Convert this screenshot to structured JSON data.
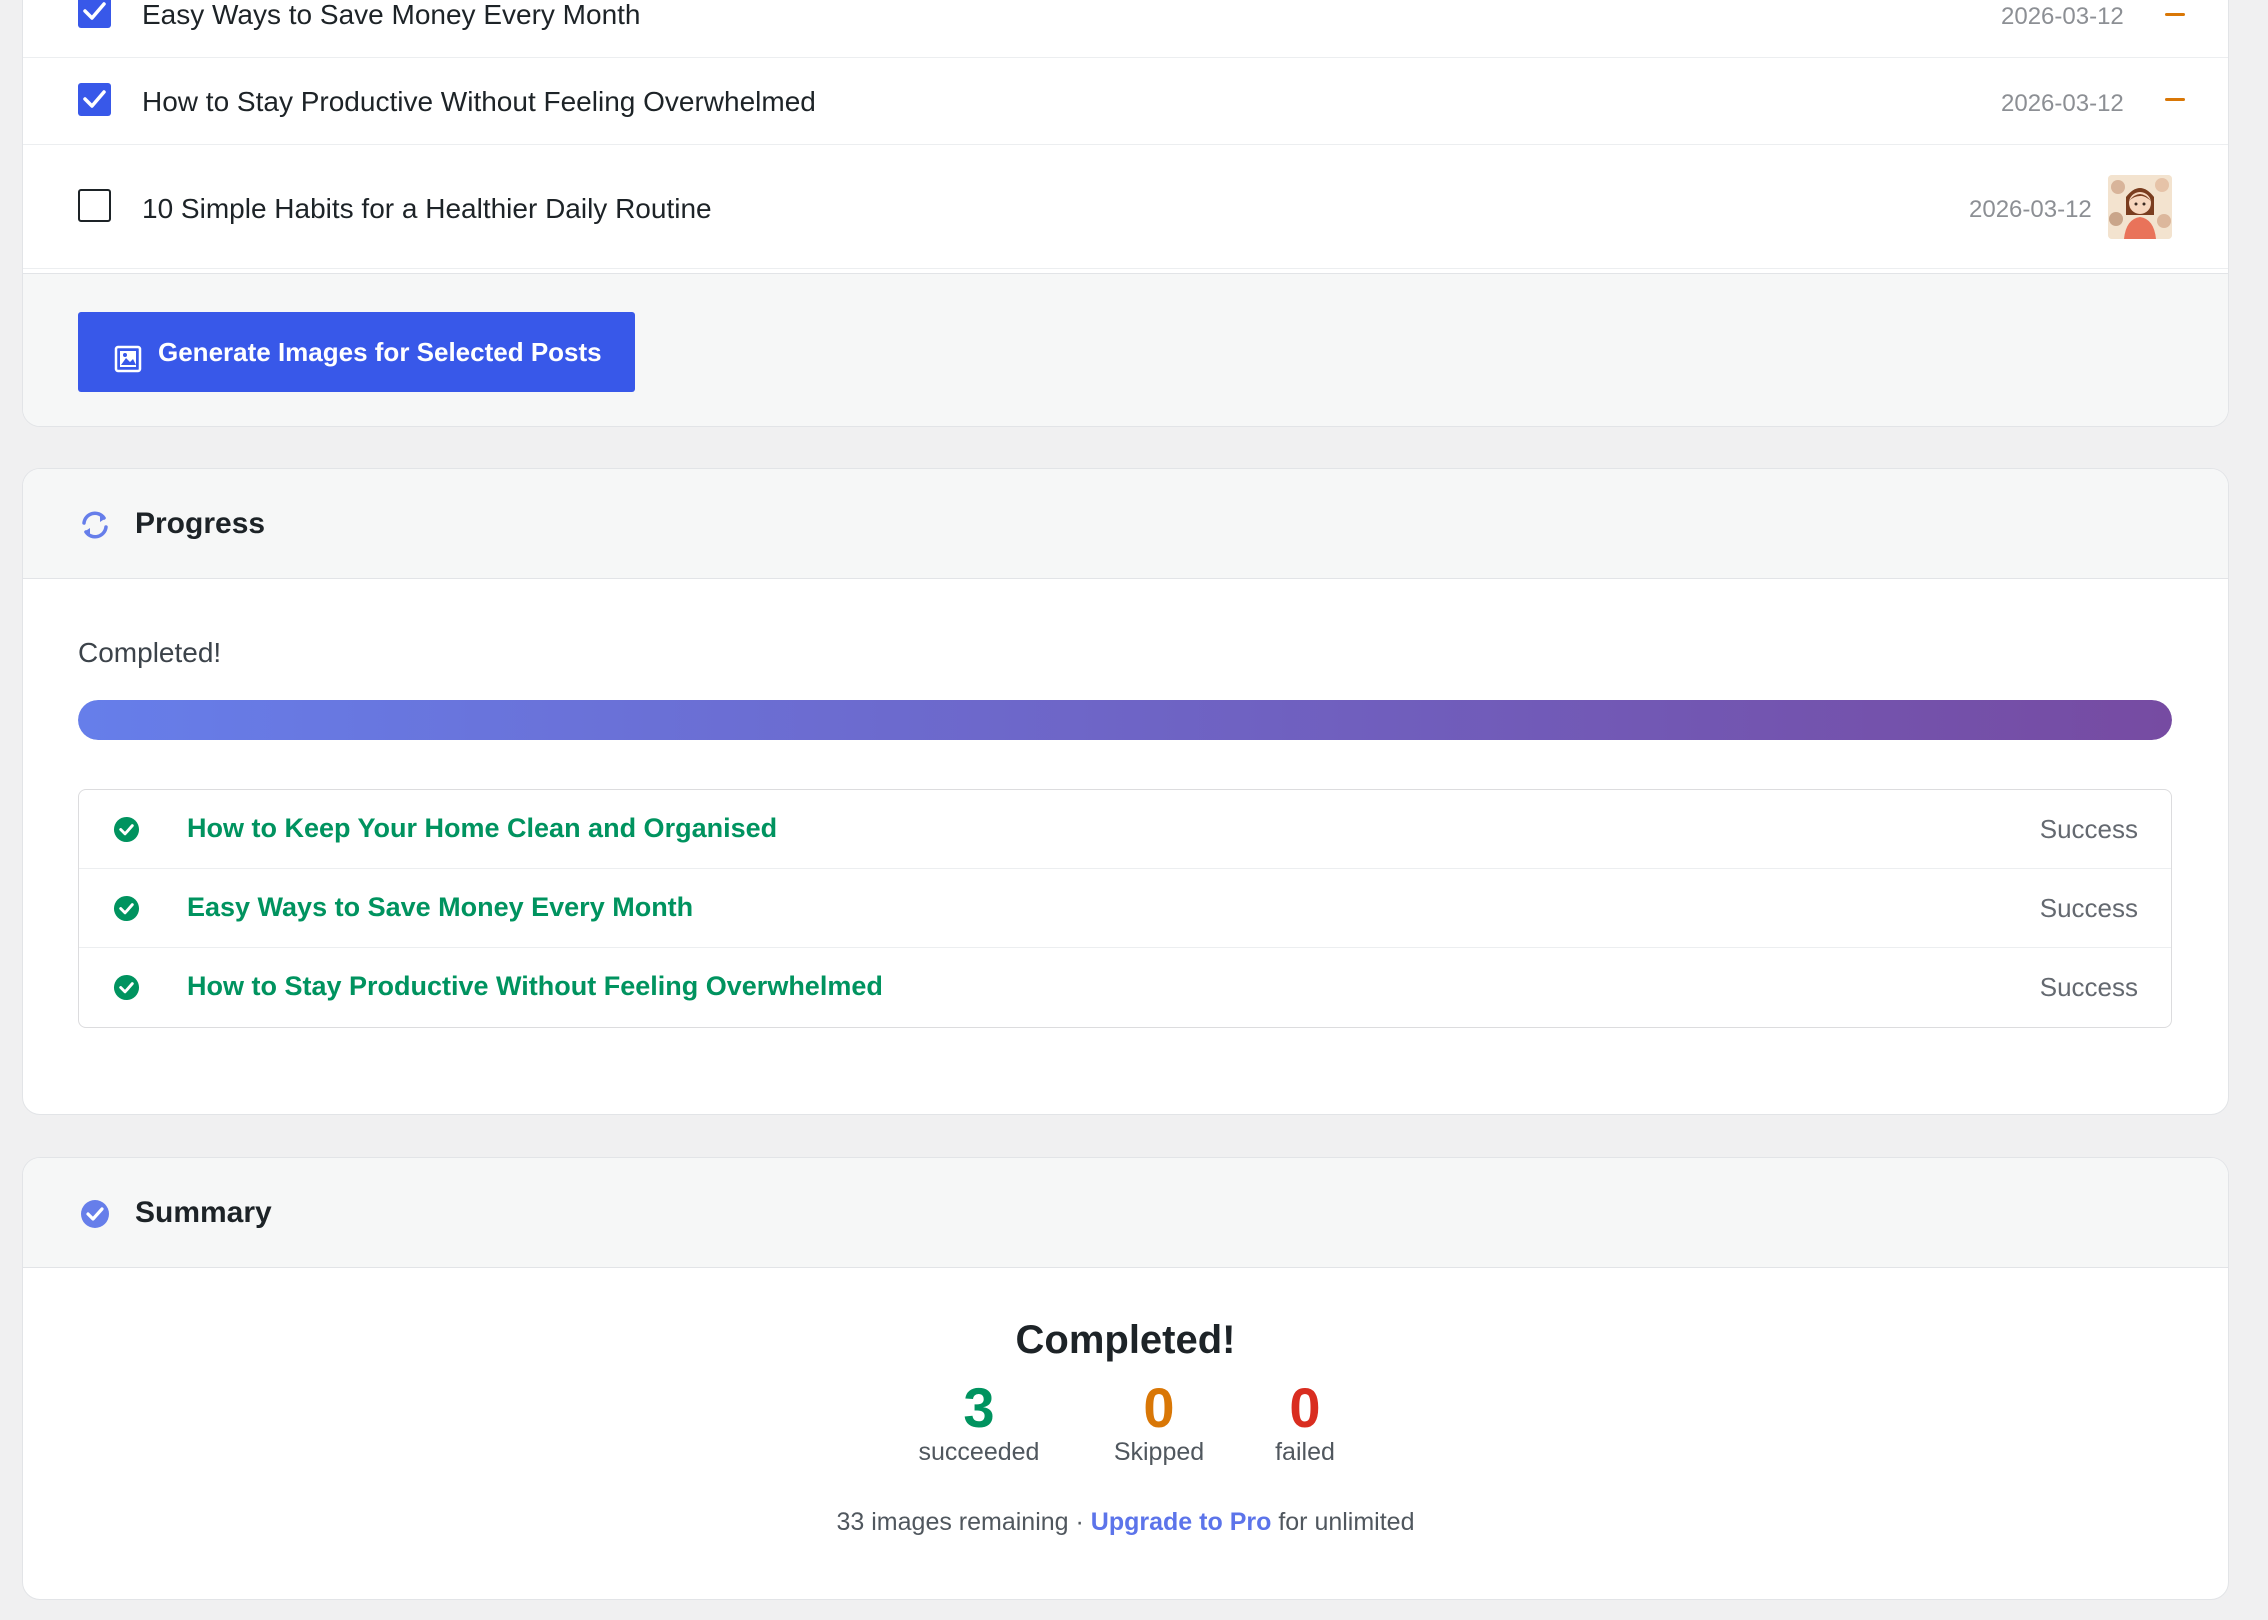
{
  "posts": [
    {
      "title": "Easy Ways to Save Money Every Month",
      "date": "2026-03-12",
      "checked": true,
      "indicator": "dash-icon"
    },
    {
      "title": "How to Stay Productive Without Feeling Overwhelmed",
      "date": "2026-03-12",
      "checked": true,
      "indicator": "dash-icon"
    },
    {
      "title": "10 Simple Habits for a Healthier Daily Routine",
      "date": "2026-03-12",
      "checked": false,
      "indicator": "thumbnail-image"
    }
  ],
  "generate_button": {
    "label": "Generate Images for Selected Posts",
    "icon": "image-icon"
  },
  "progress": {
    "title": "Progress",
    "icon": "refresh-icon",
    "status_text": "Completed!",
    "percent": 100,
    "results": [
      {
        "title": "How to Keep Your Home Clean and Organised",
        "status": "Success",
        "icon": "check-circle-icon"
      },
      {
        "title": "Easy Ways to Save Money Every Month",
        "status": "Success",
        "icon": "check-circle-icon"
      },
      {
        "title": "How to Stay Productive Without Feeling Overwhelmed",
        "status": "Success",
        "icon": "check-circle-icon"
      }
    ]
  },
  "summary": {
    "title": "Summary",
    "icon": "badge-check-icon",
    "heading": "Completed!",
    "stats": {
      "succeeded": {
        "value": "3",
        "label": "succeeded",
        "color": "#00935f"
      },
      "skipped": {
        "value": "0",
        "label": "Skipped",
        "color": "#d97706"
      },
      "failed": {
        "value": "0",
        "label": "failed",
        "color": "#d92d20"
      }
    },
    "remaining_text": "33 images remaining · ",
    "upgrade_link": "Upgrade to Pro",
    "after_link": " for unlimited"
  },
  "colors": {
    "accent": "#3858e9",
    "success": "#00935f",
    "warning": "#d97706",
    "danger": "#d92d20",
    "progress_gradient_start": "#667eea",
    "progress_gradient_end": "#764ba2"
  }
}
